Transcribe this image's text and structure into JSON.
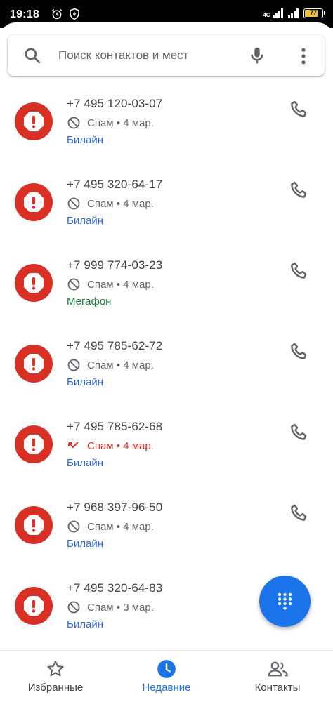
{
  "status_bar": {
    "time": "19:18",
    "network": "4G",
    "battery_text": "77",
    "battery_level": 0.77,
    "icons": [
      "alarm-icon",
      "shield-icon",
      "signal-icon",
      "battery-icon"
    ]
  },
  "search": {
    "placeholder": "Поиск контактов и мест",
    "value": ""
  },
  "calls": [
    {
      "number": "+7 495 120-03-07",
      "status": "Спам • 4 мар.",
      "carrier": "Билайн",
      "missed": false
    },
    {
      "number": "+7 495 320-64-17",
      "status": "Спам • 4 мар.",
      "carrier": "Билайн",
      "missed": false
    },
    {
      "number": "+7 999 774-03-23",
      "status": "Спам • 4 мар.",
      "carrier": "Мегафон",
      "missed": false
    },
    {
      "number": "+7 495 785-62-72",
      "status": "Спам • 4 мар.",
      "carrier": "Билайн",
      "missed": false
    },
    {
      "number": "+7 495 785-62-68",
      "status": "Спам • 4 мар.",
      "carrier": "Билайн",
      "missed": true
    },
    {
      "number": "+7 968 397-96-50",
      "status": "Спам • 4 мар.",
      "carrier": "Билайн",
      "missed": false
    },
    {
      "number": "+7 495 320-64-83",
      "status": "Спам • 3 мар.",
      "carrier": "Билайн",
      "missed": false
    }
  ],
  "bottom_nav": {
    "tabs": [
      {
        "label": "Избранные",
        "icon": "star-icon",
        "active": false
      },
      {
        "label": "Недавние",
        "icon": "clock-icon",
        "active": true
      },
      {
        "label": "Контакты",
        "icon": "people-icon",
        "active": false
      }
    ]
  },
  "colors": {
    "accent": "#1a73e8",
    "spam_red": "#d93025",
    "carrier_blue": "#3367d6",
    "carrier_green": "#188038"
  }
}
